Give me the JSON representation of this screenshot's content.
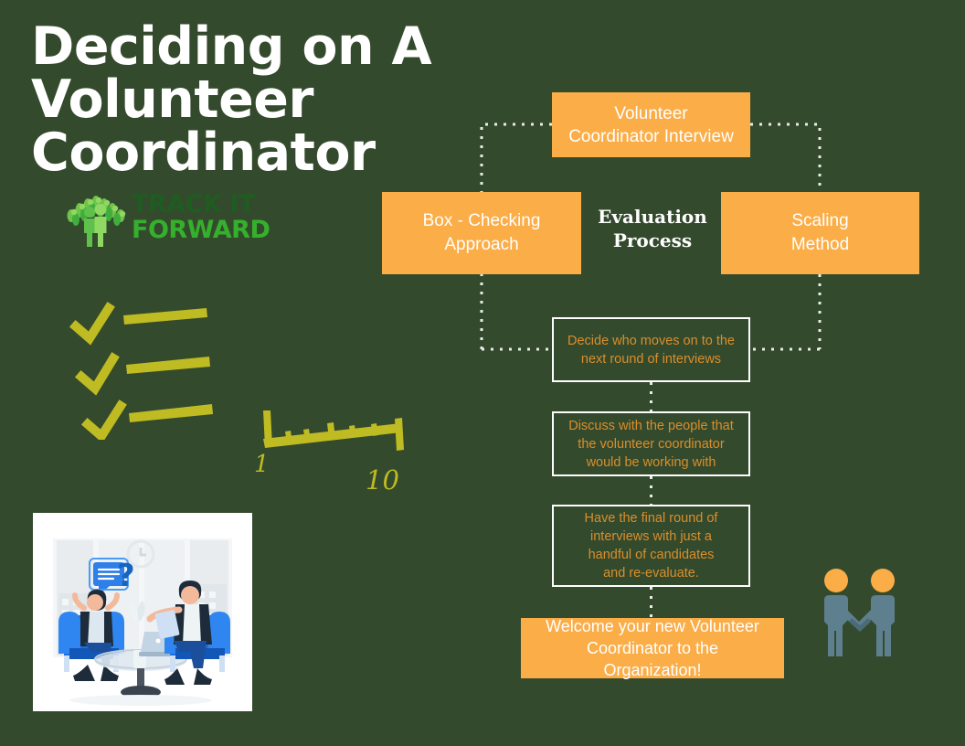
{
  "page": {
    "background_color": "#344a2d",
    "accent_orange": "#fbad47",
    "outline_text_orange": "#d98e2b",
    "decor_yellow": "#bfbb22",
    "title_color": "#ffffff"
  },
  "header": {
    "title_line1": "Deciding on A",
    "title_line2": "Volunteer",
    "title_line3": "Coordinator"
  },
  "logo": {
    "line1": "TRACK IT",
    "line2": "FORWARD",
    "line1_color": "#1f5c22",
    "line2_color": "#35b02c"
  },
  "decor": {
    "ruler_min_label": "1",
    "ruler_max_label": "10"
  },
  "flow": {
    "center_label_line1": "Evaluation",
    "center_label_line2": "Process",
    "boxes": [
      {
        "id": "interview",
        "style": "solid",
        "lines": [
          "Volunteer",
          "Coordinator Interview"
        ]
      },
      {
        "id": "box-checking",
        "style": "solid",
        "lines": [
          "Box - Checking",
          "Approach"
        ]
      },
      {
        "id": "scaling",
        "style": "solid",
        "lines": [
          "Scaling",
          "Method"
        ]
      },
      {
        "id": "decide",
        "style": "outline",
        "lines": [
          "Decide who moves on to the",
          "next round of interviews"
        ]
      },
      {
        "id": "discuss",
        "style": "outline",
        "lines": [
          "Discuss with the people that",
          "the volunteer coordinator",
          "would be working with"
        ]
      },
      {
        "id": "final-round",
        "style": "outline",
        "lines": [
          "Have the final round of",
          "interviews with just a",
          "handful of candidates",
          "and re-evaluate."
        ]
      },
      {
        "id": "welcome",
        "style": "solid",
        "lines": [
          "Welcome your new Volunteer",
          "Coordinator to the",
          "Organization!"
        ]
      }
    ]
  }
}
